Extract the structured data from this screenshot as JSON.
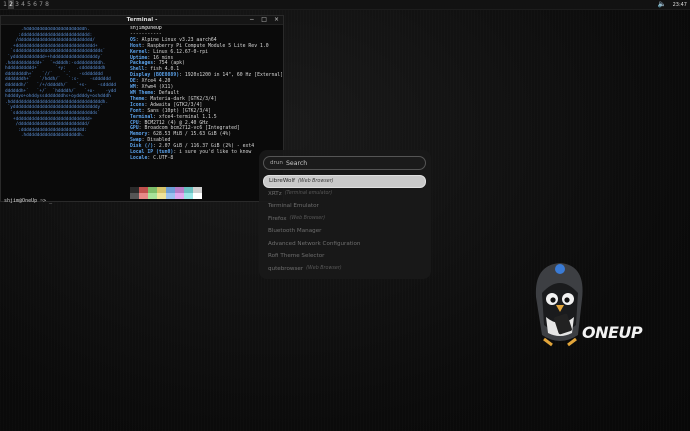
{
  "panel": {
    "workspaces": [
      "1",
      "2",
      "3",
      "4",
      "5",
      "6",
      "7",
      "8"
    ],
    "active_workspace": "2",
    "volume_icon": "speaker-icon",
    "clock": "23:47"
  },
  "terminal": {
    "title": "Terminal - ",
    "buttons": [
      "−",
      "□",
      "×"
    ],
    "ascii_art": [
      "      .hddddddddddddddddddddddh.",
      "     :dddddddddddddddddddddddddd:",
      "    /dddddddddddddddddddddddddddd/",
      "   +dddddddddddddddddddddddddddddd+",
      "  `sdddddddddddddddddddddddddddddddds`",
      " `ydddddddddddd++hdddddddddddddddddy`",
      ".hddddddddddd+`  `+ddddh:-sdddddddddh.",
      "hdddddddddd+`      `+y:    .sddddddddh",
      "ddddddddh+`   `//`    `.`   -sddddddd",
      "dddddddh+`   `/hddh/`   `:s-    -sdddddd",
      "ddddddh/`   `/+/dddddh/`   `+s-    -sddddd",
      "ddddddh+`   `+/`  `hddddh/`   `+o-    -ydd",
      "hddddyo+ohddyssdddddddhs+oyddddy+oshdddh",
      ".hdddddddddddddddddddddddddddddddddddh.",
      " `yddddddddddddddddddddddddddddddddy`",
      "  `sdddddddddddddddddddddddddddddds`",
      "   +dddddddddddddddddddddddddddd+",
      "    /dddddddddddddddddddddddddd/",
      "     :dddddddddddddddddddddddd:",
      "      .hddddddddddddddddddddh."
    ],
    "header": "shjim@OneUp",
    "separator": "-----------",
    "info": [
      {
        "k": "OS",
        "v": "Alpine Linux v3.23 aarch64"
      },
      {
        "k": "Host",
        "v": "Raspberry Pi Compute Module 5 Lite Rev 1.0"
      },
      {
        "k": "Kernel",
        "v": "Linux 6.12.67-0-rpi"
      },
      {
        "k": "Uptime",
        "v": "16 mins"
      },
      {
        "k": "Packages",
        "v": "754 (apk)"
      },
      {
        "k": "Shell",
        "v": "fish 4.0.1"
      },
      {
        "k": "Display (BOE0889)",
        "v": "1920x1200 in 14\", 60 Hz [External]"
      },
      {
        "k": "DE",
        "v": "Xfce4 4.20"
      },
      {
        "k": "WM",
        "v": "Xfwm4 (X11)"
      },
      {
        "k": "WM Theme",
        "v": "Default"
      },
      {
        "k": "Theme",
        "v": "Materia-dark [GTK2/3/4]"
      },
      {
        "k": "Icons",
        "v": "Adwaita [GTK2/3/4]"
      },
      {
        "k": "Font",
        "v": "Sans (10pt) [GTK2/3/4]"
      },
      {
        "k": "Terminal",
        "v": "xfce4-terminal 1.1.5"
      },
      {
        "k": "CPU",
        "v": "BCM2712 (4) @ 2.40 GHz"
      },
      {
        "k": "GPU",
        "v": "Broadcom bcm2712-vc6 [Integrated]"
      },
      {
        "k": "Memory",
        "v": "628.53 MiB / 15.63 GiB (4%)"
      },
      {
        "k": "Swap",
        "v": "Disabled"
      },
      {
        "k": "Disk (/)",
        "v": "2.07 GiB / 116.37 GiB (2%) - ext4"
      },
      {
        "k": "Local IP (tun0)",
        "v": "i sure you'd like to know"
      },
      {
        "k": "Locale",
        "v": "C.UTF-8"
      }
    ],
    "swatch_colors": [
      "#2b2b2b",
      "#c0504d",
      "#7dbd6a",
      "#d6c36a",
      "#6d9ed6",
      "#b77dc6",
      "#6ac0c0",
      "#d0d0d0",
      "#555555",
      "#e78a88",
      "#a8e29a",
      "#efe39a",
      "#9cc2ef",
      "#e2a8ef",
      "#9ae6e6",
      "#ffffff"
    ],
    "prompt": "shjim@OneUp ~> _"
  },
  "launcher": {
    "mode": "drun",
    "placeholder": "Search",
    "items": [
      {
        "name": "LibreWolf",
        "sub": "(Web Browser)"
      },
      {
        "name": "XRTz",
        "sub": "(Terminal emulator)"
      },
      {
        "name": "Terminal Emulator",
        "sub": ""
      },
      {
        "name": "Firefox",
        "sub": "(Web Browser)"
      },
      {
        "name": "Bluetooth Manager",
        "sub": ""
      },
      {
        "name": "Advanced Network Configuration",
        "sub": ""
      },
      {
        "name": "Rofi Theme Selector",
        "sub": ""
      },
      {
        "name": "qutebrowser",
        "sub": "(Web Browser)"
      }
    ]
  },
  "brand": {
    "logo": "ONEUP"
  }
}
